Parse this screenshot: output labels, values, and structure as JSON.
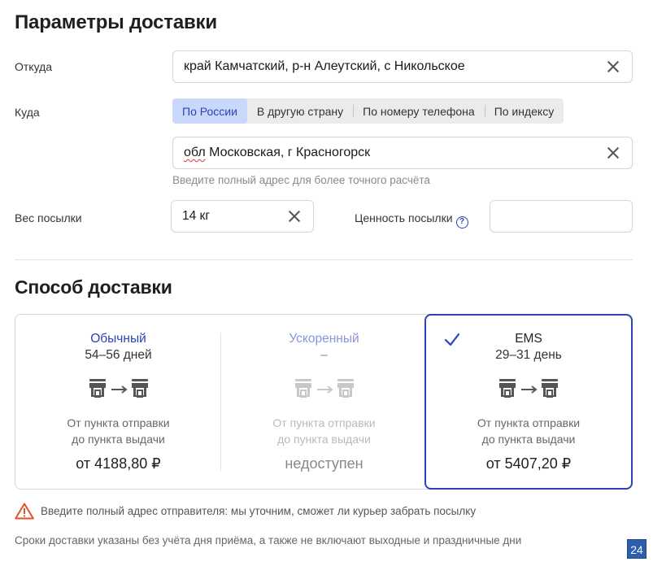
{
  "page": {
    "title": "Параметры доставки"
  },
  "from": {
    "label": "Откуда",
    "value": "край Камчатский, р-н Алеутский, с Никольское"
  },
  "to": {
    "label": "Куда",
    "tabs": [
      {
        "label": "По России",
        "active": true
      },
      {
        "label": "В другую страну",
        "active": false
      },
      {
        "label": "По номеру телефона",
        "active": false
      },
      {
        "label": "По индексу",
        "active": false
      }
    ],
    "value_prefix": "обл",
    "value_rest": " Московская, г Красногорск",
    "hint": "Введите полный адрес для более точного расчёта"
  },
  "weight": {
    "label": "Вес посылки",
    "value": "14 кг"
  },
  "declared_value": {
    "label": "Ценность посылки",
    "help": "?",
    "value": ""
  },
  "delivery": {
    "title": "Способ доставки",
    "options": [
      {
        "name": "Обычный",
        "days": "54–56 дней",
        "desc1": "От пункта отправки",
        "desc2": "до пункта выдачи",
        "price": "от 4188,80 ₽",
        "selected": false,
        "available": true
      },
      {
        "name": "Ускоренный",
        "days": "–",
        "desc1": "От пункта отправки",
        "desc2": "до пункта выдачи",
        "price": "недоступен",
        "selected": false,
        "available": false
      },
      {
        "name": "EMS",
        "days": "29–31 день",
        "desc1": "От пункта отправки",
        "desc2": "до пункта выдачи",
        "price": "от 5407,20 ₽",
        "selected": true,
        "available": true
      }
    ]
  },
  "warning": {
    "icon": "warning-triangle-icon",
    "text": "Введите полный адрес отправителя: мы уточним, сможет ли курьер забрать посылку"
  },
  "note": "Сроки доставки указаны без учёта дня приёма, а также не включают выходные и праздничные дни",
  "badge": "24",
  "colors": {
    "accent": "#2b43b8",
    "tab_active_bg": "#c9d7fb",
    "warning": "#e0532a"
  }
}
